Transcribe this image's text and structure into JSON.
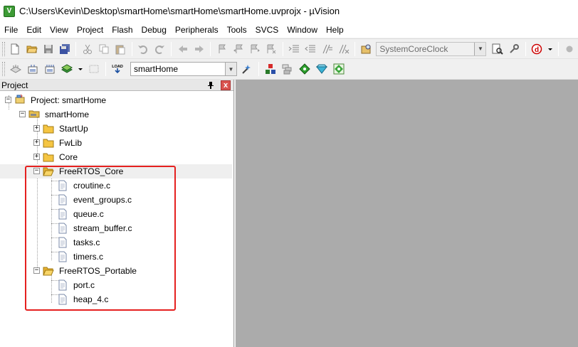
{
  "window": {
    "title": "C:\\Users\\Kevin\\Desktop\\smartHome\\smartHome\\smartHome.uvprojx - µVision",
    "logo_letter": "V"
  },
  "menu": [
    "File",
    "Edit",
    "View",
    "Project",
    "Flash",
    "Debug",
    "Peripherals",
    "Tools",
    "SVCS",
    "Window",
    "Help"
  ],
  "toolbar1": {
    "function_combo": "SystemCoreClock"
  },
  "toolbar2": {
    "load_label": "LOAD",
    "target_combo": "smartHome"
  },
  "project_panel": {
    "title": "Project",
    "pin_glyph": "ᵖ",
    "close_glyph": "x"
  },
  "tree": {
    "project_root": "Project: smartHome",
    "target": "smartHome",
    "groups": {
      "startup": "StartUp",
      "fwlib": "FwLib",
      "core": "Core",
      "freertos_core": "FreeRTOS_Core",
      "freertos_portable": "FreeRTOS_Portable"
    },
    "freertos_core_files": [
      "croutine.c",
      "event_groups.c",
      "queue.c",
      "stream_buffer.c",
      "tasks.c",
      "timers.c"
    ],
    "freertos_portable_files": [
      "port.c",
      "heap_4.c"
    ]
  },
  "colors": {
    "highlight_box": "#e5201f",
    "workspace_bg": "#ababab",
    "folder": "#f5c542"
  }
}
